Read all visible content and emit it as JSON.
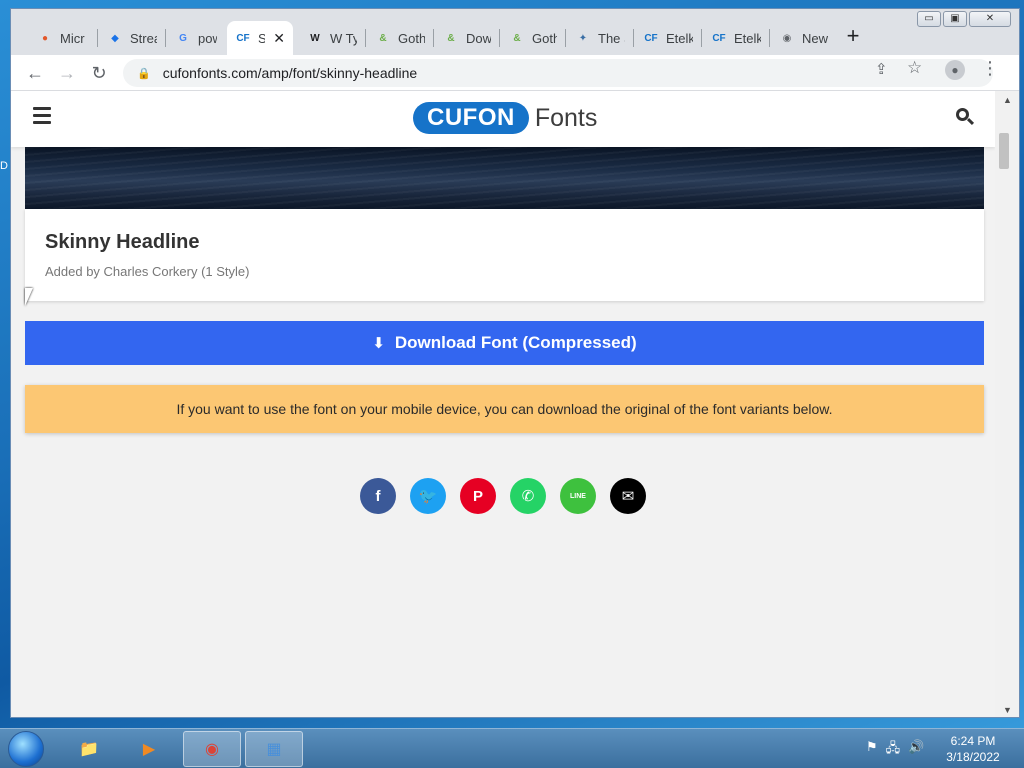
{
  "desktop": {
    "edge_letter": "D"
  },
  "browser": {
    "tabs": [
      {
        "favicon": "microsoft-edge-icon",
        "favicon_text": "●",
        "label": "Micr",
        "color": "#e2582b"
      },
      {
        "favicon": "stream-icon",
        "favicon_text": "◆",
        "label": "Strea",
        "color": "#1a73e8"
      },
      {
        "favicon": "google-icon",
        "favicon_text": "G",
        "label": "powe",
        "color": "#4285f4"
      },
      {
        "favicon": "cufon-icon",
        "favicon_text": "CF",
        "label": "S",
        "color": "#1673c9",
        "active": true
      },
      {
        "favicon": "w-icon",
        "favicon_text": "W",
        "label": "W Ty",
        "color": "#202124"
      },
      {
        "favicon": "ampersand-icon",
        "favicon_text": "&",
        "label": "Goth",
        "color": "#6cae4a"
      },
      {
        "favicon": "ampersand-icon",
        "favicon_text": "&",
        "label": "Dow",
        "color": "#6cae4a"
      },
      {
        "favicon": "ampersand-icon",
        "favicon_text": "&",
        "label": "Goth",
        "color": "#6cae4a"
      },
      {
        "favicon": "bird-icon",
        "favicon_text": "✦",
        "label": "The S",
        "color": "#3a6ea5"
      },
      {
        "favicon": "cufon-icon",
        "favicon_text": "CF",
        "label": "Etelk",
        "color": "#1673c9"
      },
      {
        "favicon": "cufon-icon",
        "favicon_text": "CF",
        "label": "Etelk",
        "color": "#1673c9"
      },
      {
        "favicon": "chrome-icon",
        "favicon_text": "◉",
        "label": "New",
        "color": "#5f6368"
      }
    ],
    "new_tab_label": "+",
    "window_controls": {
      "minimize": "▭",
      "restore": "▣",
      "close": "✕"
    },
    "nav": {
      "back": "←",
      "forward": "→",
      "reload": "↻"
    },
    "address_bar": {
      "lock": "🔒",
      "url": "cufonfonts.com/amp/font/skinny-headline"
    },
    "omnibox_icons": {
      "share": "⇪",
      "star": "☆",
      "profile": "●",
      "menu": "⋮"
    }
  },
  "site": {
    "logo_pill": "CUFON",
    "logo_text": "Fonts",
    "font_name": "Skinny Headline",
    "meta": "Added by Charles Corkery (1 Style)",
    "download_label": "Download Font (Compressed)",
    "download_icon": "⬇",
    "notice": "If you want to use the font on your mobile device, you can download the original of the font variants below.",
    "share": [
      {
        "name": "facebook-icon",
        "glyph": "f",
        "color": "#3b5998"
      },
      {
        "name": "twitter-icon",
        "glyph": "🐦",
        "color": "#1da1f2"
      },
      {
        "name": "pinterest-icon",
        "glyph": "P",
        "color": "#e60023"
      },
      {
        "name": "whatsapp-icon",
        "glyph": "✆",
        "color": "#25d366"
      },
      {
        "name": "line-icon",
        "glyph": "LINE",
        "color": "#3ec13e"
      },
      {
        "name": "email-icon",
        "glyph": "✉",
        "color": "#000000"
      }
    ]
  },
  "scrollbar": {
    "up": "▲",
    "down": "▼"
  },
  "taskbar": {
    "items": [
      {
        "name": "file-explorer-icon",
        "glyph": "📁",
        "color": "#e8c35a",
        "active": false
      },
      {
        "name": "media-player-icon",
        "glyph": "▶",
        "color": "#f08a24",
        "active": false
      },
      {
        "name": "chrome-icon",
        "glyph": "◉",
        "color": "#db4437",
        "active": true
      },
      {
        "name": "control-panel-icon",
        "glyph": "▦",
        "color": "#4a90d9",
        "active": true
      }
    ],
    "tray": {
      "flag": "⚑",
      "network": "🖧",
      "volume": "🔊"
    },
    "time": "6:24 PM",
    "date": "3/18/2022"
  }
}
